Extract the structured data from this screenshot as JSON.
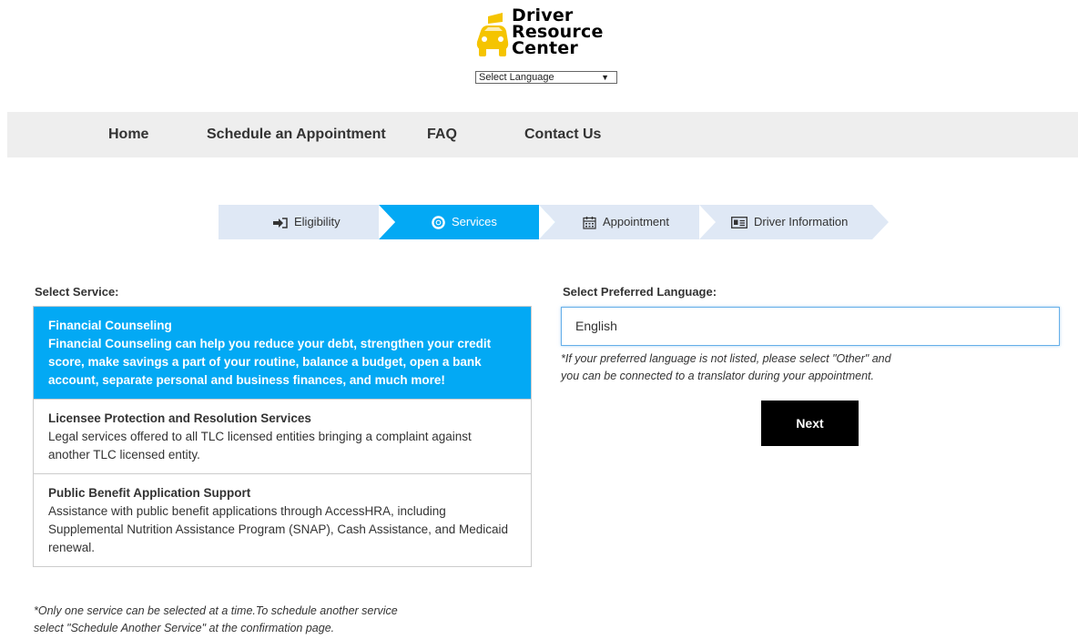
{
  "header": {
    "logo_lines": [
      "Driver",
      "Resource",
      "Center"
    ],
    "language_select": "Select Language"
  },
  "nav": {
    "items": [
      "Home",
      "Schedule an Appointment",
      "FAQ",
      "Contact Us"
    ]
  },
  "steps": [
    {
      "label": "Eligibility",
      "icon": "sign-in-icon",
      "state": "completed"
    },
    {
      "label": "Services",
      "icon": "life-ring-icon",
      "state": "active"
    },
    {
      "label": "Appointment",
      "icon": "calendar-icon",
      "state": "pending"
    },
    {
      "label": "Driver Information",
      "icon": "id-card-icon",
      "state": "pending"
    }
  ],
  "service": {
    "label": "Select Service:",
    "items": [
      {
        "title": "Financial Counseling",
        "desc": "Financial Counseling can help you reduce your debt, strengthen your credit score, make savings a part of your routine, balance a budget, open a bank account, separate personal and business finances, and much more!",
        "selected": true
      },
      {
        "title": "Licensee Protection and Resolution Services",
        "desc": "Legal services offered to all TLC licensed entities bringing a complaint against another TLC licensed entity.",
        "selected": false
      },
      {
        "title": "Public Benefit Application Support",
        "desc": "Assistance with public benefit applications through AccessHRA, including Supplemental Nutrition Assistance Program (SNAP), Cash Assistance, and Medicaid renewal.",
        "selected": false
      }
    ],
    "note_line1": "*Only one service can be selected at a time.To schedule another service",
    "note_line2": "select \"Schedule Another Service\" at the confirmation page."
  },
  "language": {
    "label": "Select Preferred Language:",
    "value": "English",
    "note_line1": "*If your preferred language is not listed, please select \"Other\" and",
    "note_line2": "you can be connected to a translator during your appointment."
  },
  "next_label": "Next",
  "colors": {
    "accent": "#03a9f4",
    "step_inactive": "#dfe8f5",
    "logo_yellow": "#f5c400",
    "nav_bg": "#eeeeee"
  }
}
